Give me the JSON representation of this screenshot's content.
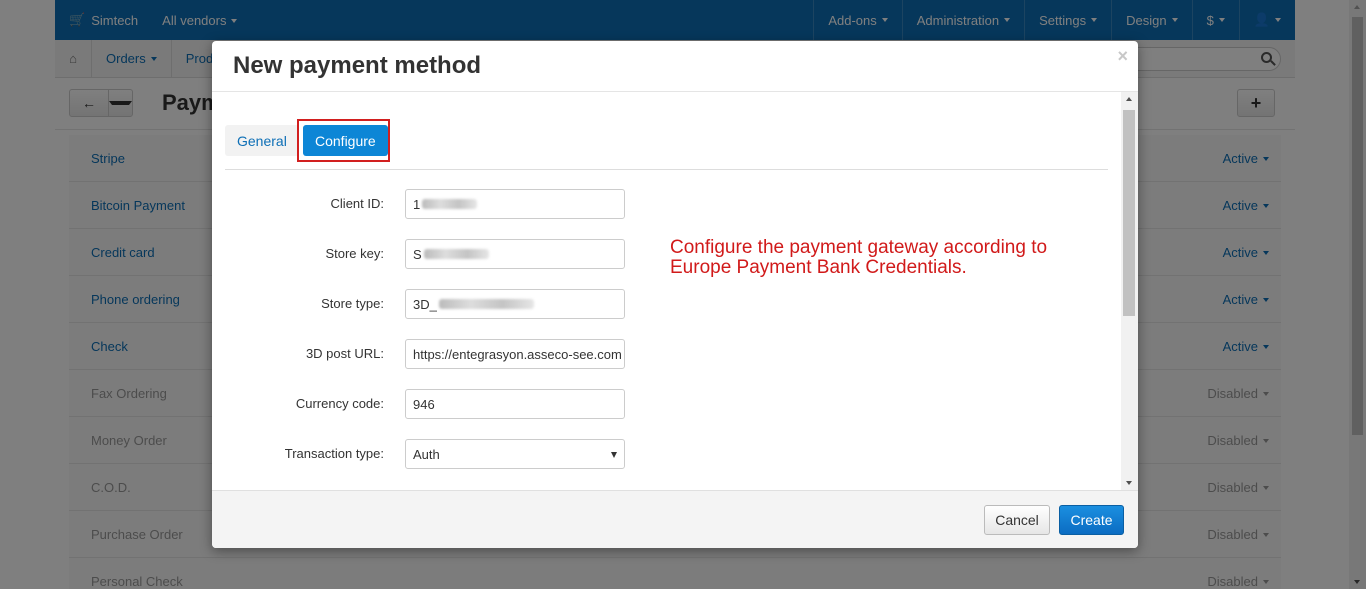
{
  "topbar": {
    "brand": "Simtech",
    "vendors": "All vendors",
    "menu": [
      "Add-ons",
      "Administration",
      "Settings",
      "Design",
      "$",
      ""
    ]
  },
  "subnav": {
    "items": [
      "Orders",
      "Prod"
    ]
  },
  "page": {
    "title": "Paym"
  },
  "payment_list": [
    {
      "name": "Stripe",
      "status": "Active",
      "enabled": true
    },
    {
      "name": "Bitcoin Payment",
      "status": "Active",
      "enabled": true
    },
    {
      "name": "Credit card",
      "status": "Active",
      "enabled": true
    },
    {
      "name": "Phone ordering",
      "status": "Active",
      "enabled": true
    },
    {
      "name": "Check",
      "status": "Active",
      "enabled": true
    },
    {
      "name": "Fax Ordering",
      "status": "Disabled",
      "enabled": false
    },
    {
      "name": "Money Order",
      "status": "Disabled",
      "enabled": false
    },
    {
      "name": "C.O.D.",
      "status": "Disabled",
      "enabled": false
    },
    {
      "name": "Purchase Order",
      "status": "Disabled",
      "enabled": false
    },
    {
      "name": "Personal Check",
      "status": "Disabled",
      "enabled": false
    }
  ],
  "modal": {
    "title": "New payment method",
    "close": "×",
    "tabs": {
      "general": "General",
      "configure": "Configure"
    },
    "fields": {
      "client_id": {
        "label": "Client ID:",
        "value": "1"
      },
      "store_key": {
        "label": "Store key:",
        "value": "S"
      },
      "store_type": {
        "label": "Store type:",
        "value": "3D_"
      },
      "post_url": {
        "label": "3D post URL:",
        "value": "https://entegrasyon.asseco-see.com"
      },
      "currency_code": {
        "label": "Currency code:",
        "value": "946"
      },
      "transaction_type": {
        "label": "Transaction type:",
        "value": "Auth"
      }
    },
    "annotation": "Configure the payment gateway according to Europe Payment Bank Credentials.",
    "buttons": {
      "cancel": "Cancel",
      "create": "Create"
    }
  },
  "colors": {
    "primary": "#0d6fb6",
    "annotation": "#d11a1a",
    "highlight": "#d21f1f"
  }
}
